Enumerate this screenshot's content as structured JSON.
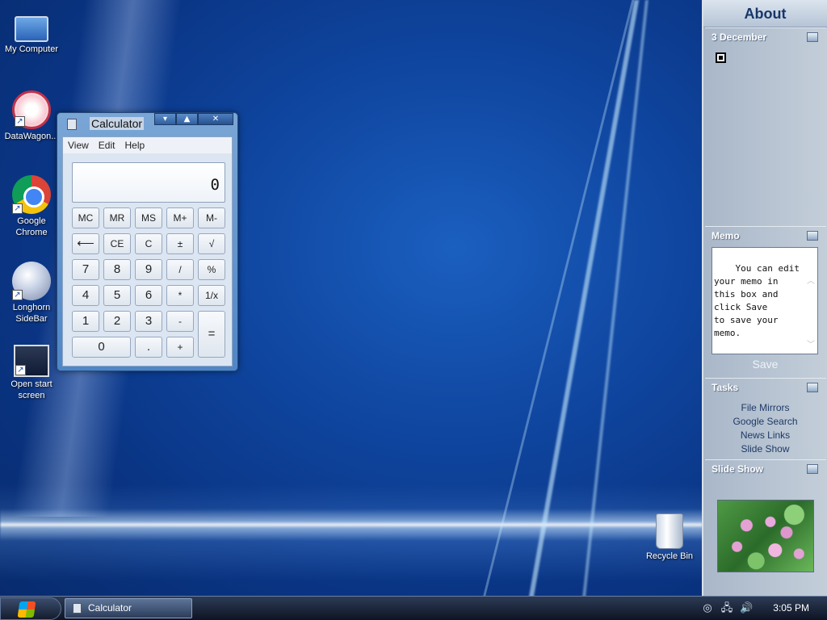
{
  "desktop": {
    "icons": [
      {
        "label": "My Computer",
        "icon": "computer-icon"
      },
      {
        "label": "DataWagon...",
        "icon": "datawagon-icon"
      },
      {
        "label": "Google Chrome",
        "icon": "chrome-icon"
      },
      {
        "label": "Longhorn SideBar",
        "icon": "longhorn-sidebar-icon"
      },
      {
        "label": "Open start screen",
        "icon": "start-screen-icon"
      },
      {
        "label": "Recycle Bin",
        "icon": "recycle-bin-icon"
      }
    ]
  },
  "calculator": {
    "title": "Calculator",
    "window_buttons": {
      "minimize": "▾",
      "maximize": "▲",
      "close": "✕"
    },
    "menu": [
      "View",
      "Edit",
      "Help"
    ],
    "display_value": "0",
    "memory_row": [
      "MC",
      "MR",
      "MS",
      "M+",
      "M-"
    ],
    "row2": [
      "⟵",
      "CE",
      "C",
      "±",
      "√"
    ],
    "row3": [
      "7",
      "8",
      "9",
      "/",
      "%"
    ],
    "row4": [
      "4",
      "5",
      "6",
      "*",
      "1/x"
    ],
    "row5": [
      "1",
      "2",
      "3",
      "-"
    ],
    "row6": [
      "0",
      ".",
      "+"
    ],
    "equals": "="
  },
  "sidebar": {
    "title": "About",
    "calendar": {
      "date": "3 December"
    },
    "memo": {
      "heading": "Memo",
      "text": "You can edit\nyour memo in\nthis box and\nclick Save\nto save your\nmemo.",
      "save_label": "Save"
    },
    "tasks": {
      "heading": "Tasks",
      "items": [
        "File Mirrors",
        "Google Search",
        "News Links",
        "Slide Show"
      ]
    },
    "slideshow": {
      "heading": "Slide Show"
    }
  },
  "taskbar": {
    "start_icon": "windows-logo-icon",
    "items": [
      {
        "label": "Calculator"
      }
    ],
    "clock": "3:05 PM"
  },
  "colors": {
    "desktop_bg": "#0f46a0",
    "taskbar_bg": "#1a2438",
    "sidebar_bg": "#b6c3d2",
    "sidebar_title": "#17376a"
  }
}
